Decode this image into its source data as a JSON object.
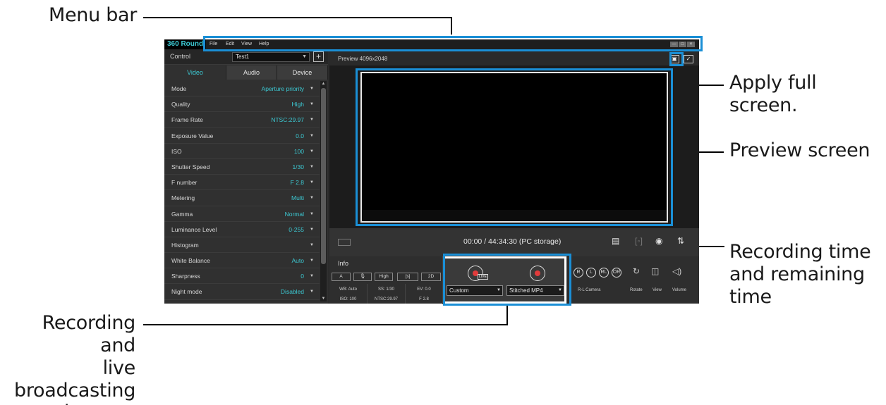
{
  "callouts": {
    "menu_bar": "Menu bar",
    "apply_full_screen": "Apply full screen.",
    "preview_screen": "Preview screen",
    "recording_time_1": "Recording time",
    "recording_time_2": "and remaining",
    "recording_time_3": "time",
    "rec_live_1": "Recording and",
    "rec_live_2": "live",
    "rec_live_3": "broadcasting",
    "rec_live_4": "buttons"
  },
  "app": {
    "brand": "360 Round",
    "menu": [
      "File",
      "Edit",
      "View",
      "Help"
    ],
    "window_buttons": [
      "—",
      "□",
      "×"
    ]
  },
  "control": {
    "label": "Control",
    "preset": "Test1",
    "add": "+"
  },
  "tabs": [
    "Video",
    "Audio",
    "Device"
  ],
  "params": [
    {
      "label": "Mode",
      "value": "Aperture priority"
    },
    {
      "label": "Quality",
      "value": "High"
    },
    {
      "label": "Frame Rate",
      "value": "NTSC:29.97"
    },
    {
      "label": "Exposure Value",
      "value": "0.0"
    },
    {
      "label": "ISO",
      "value": "100"
    },
    {
      "label": "Shutter Speed",
      "value": "1/30"
    },
    {
      "label": "F number",
      "value": "F 2.8"
    },
    {
      "label": "Metering",
      "value": "Multi"
    },
    {
      "label": "Gamma",
      "value": "Normal"
    },
    {
      "label": "Luminance Level",
      "value": "0-255"
    },
    {
      "label": "Histogram",
      "value": ""
    },
    {
      "label": "White Balance",
      "value": "Auto"
    },
    {
      "label": "Sharpness",
      "value": "0"
    },
    {
      "label": "Night mode",
      "value": "Disabled"
    }
  ],
  "preview": {
    "title": "Preview 4096x2048",
    "time": "00:00 / 44:34:30 (PC storage)"
  },
  "info": {
    "title": "Info",
    "chips": [
      "A",
      "🎙",
      "High",
      "[s]",
      "2D"
    ],
    "row1": [
      "WB: Auto",
      "SS: 1/30",
      "EV: 0.0"
    ],
    "row2": [
      "ISO: 100",
      "NTSC:29.97",
      "F 2.8"
    ]
  },
  "record": {
    "live_label": "LIVE",
    "stream_format": "Custom",
    "record_format": "Stitched MP4"
  },
  "camera": {
    "icons": [
      "R",
      "L",
      "RL",
      "OR"
    ],
    "labels": [
      "R-L Camera",
      "Rotate",
      "View",
      "Volume"
    ]
  },
  "colors": {
    "accent": "#3cc9d3",
    "highlight": "#1a8fd6",
    "record": "#e23b3b"
  }
}
